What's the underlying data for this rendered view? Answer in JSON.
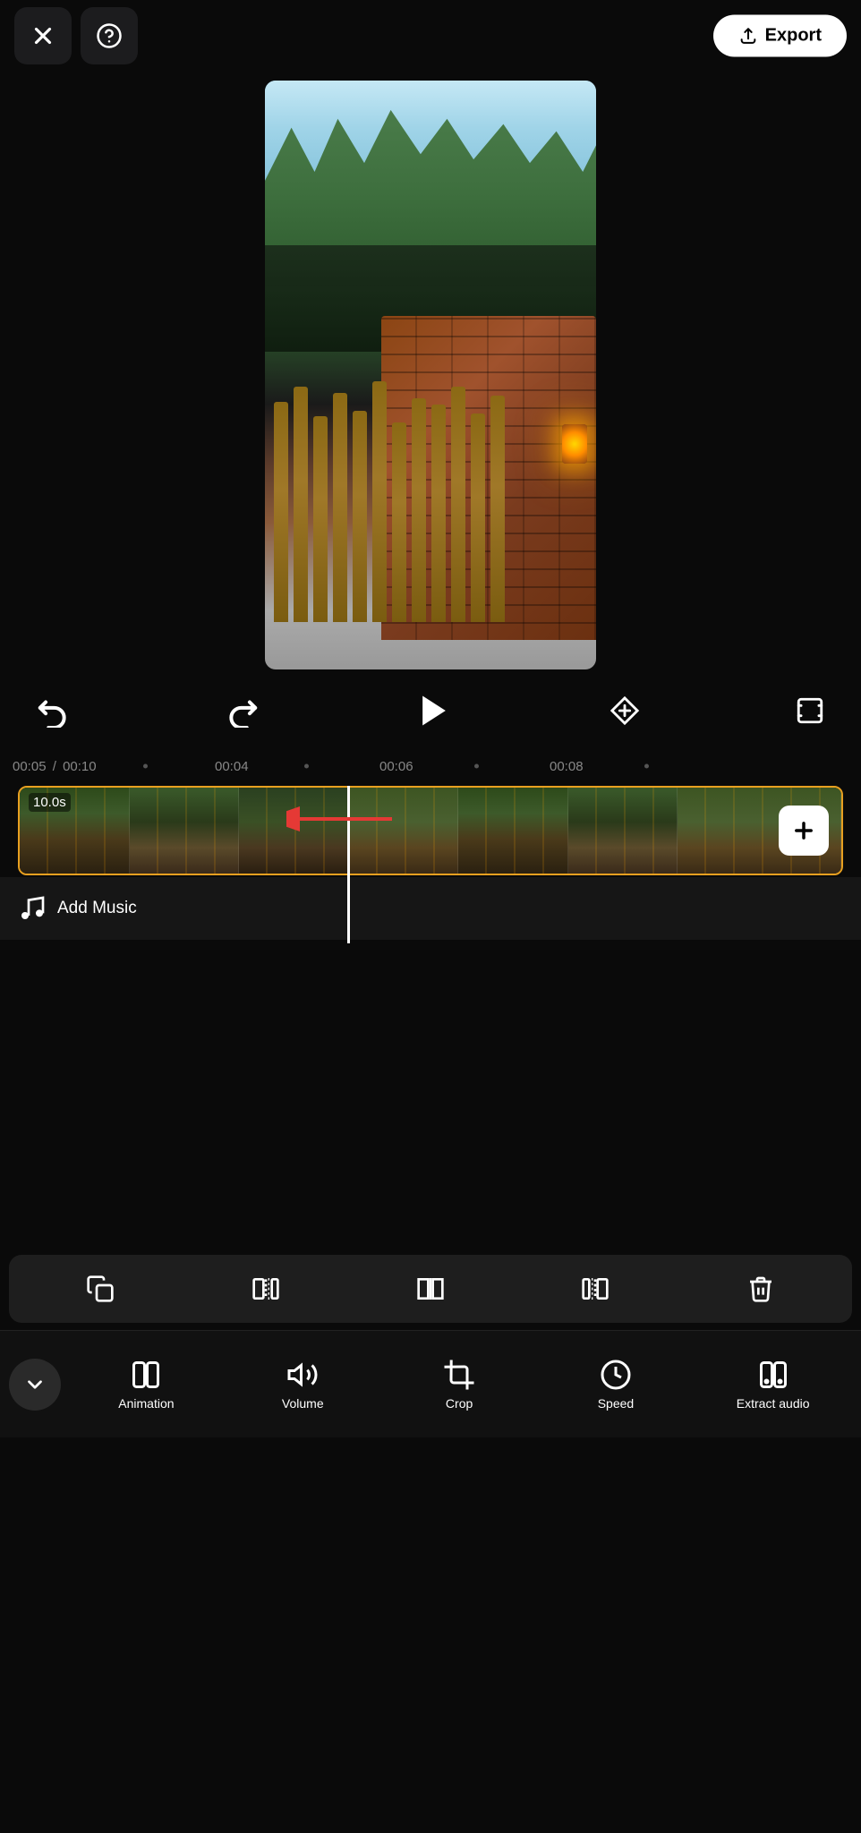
{
  "topBar": {
    "closeLabel": "✕",
    "helpLabel": "?",
    "exportLabel": "Export"
  },
  "playback": {
    "currentTime": "00:05",
    "totalTime": "00:10",
    "separator": "/"
  },
  "ruler": {
    "labels": [
      "00:05",
      "/ 00:10",
      "00:04",
      "00:06",
      "00:08"
    ]
  },
  "videoStrip": {
    "durationLabel": "10.0s"
  },
  "addMusic": {
    "label": "Add Music"
  },
  "clipTools": [
    {
      "name": "copy-clip",
      "icon": "copy"
    },
    {
      "name": "split-left",
      "icon": "split-left"
    },
    {
      "name": "split-middle",
      "icon": "split-middle"
    },
    {
      "name": "split-right",
      "icon": "split-right"
    },
    {
      "name": "delete-clip",
      "icon": "delete"
    }
  ],
  "bottomNav": {
    "collapseLabel": "▾",
    "items": [
      {
        "id": "animation",
        "label": "Animation"
      },
      {
        "id": "volume",
        "label": "Volume"
      },
      {
        "id": "crop",
        "label": "Crop"
      },
      {
        "id": "speed",
        "label": "Speed"
      },
      {
        "id": "extract-audio",
        "label": "Extract audio"
      }
    ]
  }
}
